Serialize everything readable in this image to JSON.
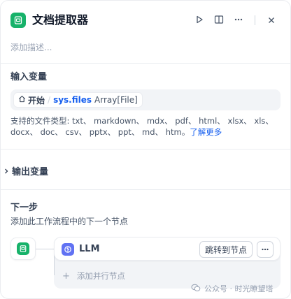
{
  "header": {
    "title": "文档提取器",
    "description_placeholder": "添加描述...",
    "icons": [
      "document-icon",
      "play-icon",
      "book-icon",
      "more-icon",
      "close-icon"
    ]
  },
  "input_section": {
    "title": "输入变量",
    "variable": {
      "source_icon": "home-icon",
      "source": "开始",
      "separator": "/",
      "name": "sys.files",
      "type": "Array[File]"
    },
    "supported_text": "支持的文件类型: txt、 markdown、 mdx、 pdf、 html、 xlsx、 xls、 docx、 doc、 csv、 pptx、 ppt、 md、 htm。",
    "learn_more": "了解更多"
  },
  "output_section": {
    "title": "输出变量",
    "icon": "chevron-right-icon"
  },
  "next_step": {
    "title": "下一步",
    "description": "添加此工作流程中的下一个节点",
    "node": {
      "icon": "brain-icon",
      "label": "LLM",
      "jump_label": "跳转到节点"
    },
    "add_parallel": "添加并行节点"
  },
  "watermark": {
    "text": "公众号 · 时光瞭望塔"
  },
  "colors": {
    "accent_green": "#17b26a",
    "llm_blue": "#6172f3",
    "link_blue": "#155eef"
  }
}
